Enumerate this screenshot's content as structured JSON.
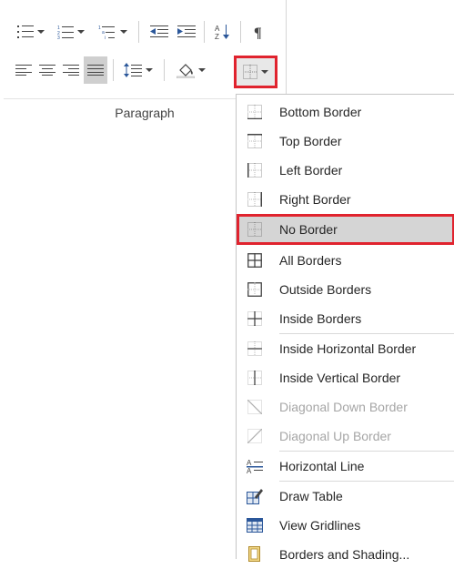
{
  "ribbon": {
    "group_label": "Paragraph",
    "row1": [
      "bullets-icon",
      "numbering-icon",
      "multilevel-list-icon",
      "decrease-indent-icon",
      "increase-indent-icon",
      "sort-icon",
      "show-marks-icon"
    ],
    "row2": [
      "align-left-icon",
      "center-icon",
      "align-right-icon",
      "justify-icon",
      "line-spacing-icon",
      "shading-icon",
      "borders-icon"
    ]
  },
  "menu": {
    "items": [
      {
        "label": "Bottom Border",
        "icon": "bottom-border-icon",
        "state": "normal"
      },
      {
        "label": "Top Border",
        "icon": "top-border-icon",
        "state": "normal"
      },
      {
        "label": "Left Border",
        "icon": "left-border-icon",
        "state": "normal"
      },
      {
        "label": "Right Border",
        "icon": "right-border-icon",
        "state": "normal"
      },
      {
        "label": "No Border",
        "icon": "no-border-icon",
        "state": "selected"
      },
      {
        "label": "All Borders",
        "icon": "all-borders-icon",
        "state": "normal"
      },
      {
        "label": "Outside Borders",
        "icon": "outside-borders-icon",
        "state": "normal"
      },
      {
        "label": "Inside Borders",
        "icon": "inside-borders-icon",
        "state": "normal"
      },
      {
        "label": "Inside Horizontal Border",
        "icon": "inside-horizontal-border-icon",
        "state": "normal"
      },
      {
        "label": "Inside Vertical Border",
        "icon": "inside-vertical-border-icon",
        "state": "normal"
      },
      {
        "label": "Diagonal Down Border",
        "icon": "diagonal-down-border-icon",
        "state": "disabled"
      },
      {
        "label": "Diagonal Up Border",
        "icon": "diagonal-up-border-icon",
        "state": "disabled"
      },
      {
        "label": "Horizontal Line",
        "icon": "horizontal-line-icon",
        "state": "normal"
      },
      {
        "label": "Draw Table",
        "icon": "draw-table-icon",
        "state": "normal"
      },
      {
        "label": "View Gridlines",
        "icon": "view-gridlines-icon",
        "state": "normal"
      },
      {
        "label": "Borders and Shading...",
        "icon": "borders-and-shading-icon",
        "state": "normal"
      }
    ]
  },
  "colors": {
    "highlight_outline": "#e0232e",
    "selected_bg": "#d5d5d5",
    "text": "#262626",
    "disabled_text": "#a6a6a6",
    "icon_blue": "#2b579a"
  }
}
